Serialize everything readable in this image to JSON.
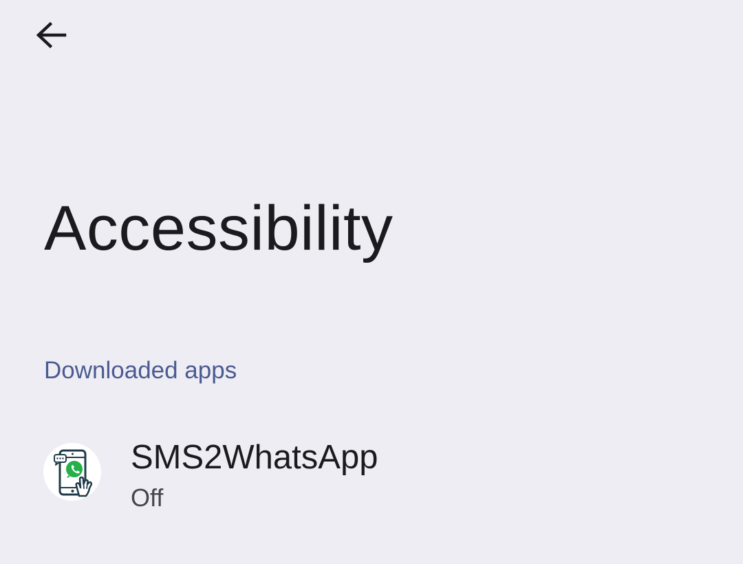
{
  "header": {
    "back_icon": "arrow-back-icon"
  },
  "page": {
    "title": "Accessibility"
  },
  "sections": [
    {
      "header": "Downloaded apps",
      "items": [
        {
          "name": "SMS2WhatsApp",
          "status": "Off",
          "icon": "sms2whatsapp-app-icon"
        }
      ]
    }
  ],
  "colors": {
    "background": "#eeedf3",
    "section_header": "#4a5b92",
    "primary_text": "#1b1b1f",
    "secondary_text": "#46464f",
    "whatsapp_green": "#25b04a",
    "icon_outline": "#1f3b4a"
  }
}
